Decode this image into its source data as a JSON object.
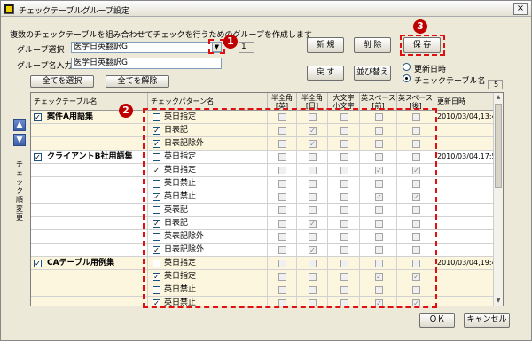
{
  "window": {
    "title": "チェックテーブルグループ設定",
    "close": "×"
  },
  "description": "複数のチェックテーブルを組み合わせてチェックを行うためのグループを作成します",
  "group_select": {
    "label": "グループ選択",
    "value": "医学日英翻訳G",
    "count": "1"
  },
  "group_name": {
    "label": "グループ名入力",
    "value": "医学日英翻訳G"
  },
  "buttons": {
    "select_all": "全てを選択",
    "clear_all": "全てを解除",
    "new": "新 規",
    "delete": "削 除",
    "save": "保 存",
    "back": "戻 す",
    "sort": "並び替え",
    "ok": "ＯＫ",
    "cancel": "キャンセル"
  },
  "sort_options": [
    {
      "label": "更新日時",
      "selected": false
    },
    {
      "label": "チェックテーブル名",
      "selected": true
    }
  ],
  "total_count": "5",
  "badges": {
    "one": "1",
    "two": "2",
    "three": "3"
  },
  "side": {
    "up": "▲",
    "down": "▼",
    "label": "チェック順変更"
  },
  "columns": [
    "チェックテーブル名",
    "チェックパターン名",
    "半全角\n[英]",
    "半全角\n[日]",
    "大文字\n小文字",
    "英スペース\n[前]",
    "英スペース\n[後]",
    "更新日時"
  ],
  "rows": [
    {
      "table": "案件A用語集",
      "table_checked": true,
      "pattern": "英日指定",
      "pattern_checked": false,
      "flags": [
        0,
        0,
        0,
        0,
        0
      ],
      "date": "2010/03/04,13:48",
      "shade": true
    },
    {
      "table": "",
      "pattern": "日表記",
      "pattern_checked": true,
      "flags": [
        0,
        1,
        0,
        0,
        0
      ],
      "date": "",
      "shade": true
    },
    {
      "table": "",
      "pattern": "日表記除外",
      "pattern_checked": true,
      "flags": [
        0,
        1,
        0,
        0,
        0
      ],
      "date": "",
      "shade": true
    },
    {
      "table": "クライアントB社用語集",
      "table_checked": true,
      "pattern": "英日指定",
      "pattern_checked": false,
      "flags": [
        0,
        0,
        0,
        0,
        0
      ],
      "date": "2010/03/04,17:59",
      "shade": false
    },
    {
      "table": "",
      "pattern": "英日指定",
      "pattern_checked": true,
      "flags": [
        0,
        0,
        0,
        1,
        1
      ],
      "date": "",
      "shade": false
    },
    {
      "table": "",
      "pattern": "英日禁止",
      "pattern_checked": false,
      "flags": [
        0,
        0,
        0,
        0,
        0
      ],
      "date": "",
      "shade": false
    },
    {
      "table": "",
      "pattern": "英日禁止",
      "pattern_checked": true,
      "flags": [
        0,
        0,
        0,
        1,
        1
      ],
      "date": "",
      "shade": false
    },
    {
      "table": "",
      "pattern": "英表記",
      "pattern_checked": false,
      "flags": [
        0,
        0,
        0,
        0,
        0
      ],
      "date": "",
      "shade": false
    },
    {
      "table": "",
      "pattern": "日表記",
      "pattern_checked": true,
      "flags": [
        0,
        1,
        0,
        0,
        0
      ],
      "date": "",
      "shade": false
    },
    {
      "table": "",
      "pattern": "英表記除外",
      "pattern_checked": false,
      "flags": [
        0,
        0,
        0,
        0,
        0
      ],
      "date": "",
      "shade": false
    },
    {
      "table": "",
      "pattern": "日表記除外",
      "pattern_checked": true,
      "flags": [
        0,
        1,
        0,
        0,
        0
      ],
      "date": "",
      "shade": false
    },
    {
      "table": "CAテーブル用例集",
      "table_checked": true,
      "pattern": "英日指定",
      "pattern_checked": false,
      "flags": [
        0,
        0,
        0,
        0,
        0
      ],
      "date": "2010/03/04,19:48",
      "shade": true
    },
    {
      "table": "",
      "pattern": "英日指定",
      "pattern_checked": true,
      "flags": [
        0,
        0,
        0,
        1,
        1
      ],
      "date": "",
      "shade": true
    },
    {
      "table": "",
      "pattern": "英日禁止",
      "pattern_checked": false,
      "flags": [
        0,
        0,
        0,
        0,
        0
      ],
      "date": "",
      "shade": true
    },
    {
      "table": "",
      "pattern": "英日禁止",
      "pattern_checked": true,
      "flags": [
        0,
        0,
        0,
        1,
        1
      ],
      "date": "",
      "shade": true
    }
  ]
}
